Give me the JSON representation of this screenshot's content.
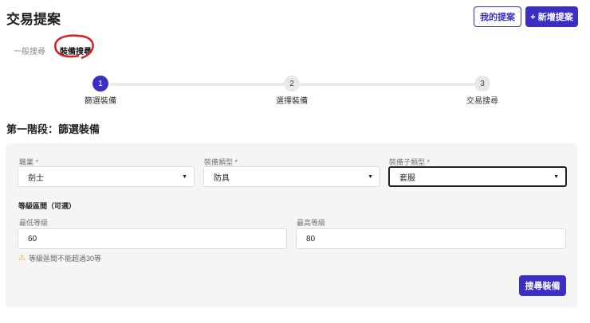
{
  "header": {
    "title": "交易提案",
    "my_proposals": "我的提案",
    "new_proposal": "+ 新增提案"
  },
  "tabs": [
    {
      "label": "一般搜尋"
    },
    {
      "label": "裝備搜尋"
    }
  ],
  "steps": [
    {
      "num": "1",
      "label": "篩選裝備"
    },
    {
      "num": "2",
      "label": "選擇裝備"
    },
    {
      "num": "3",
      "label": "交易搜尋"
    }
  ],
  "section_title": "第一階段：篩選裝備",
  "form": {
    "job": {
      "label": "職業 *",
      "value": "劍士"
    },
    "equip_type": {
      "label": "裝備類型 *",
      "value": "防具"
    },
    "equip_subtype": {
      "label": "裝備子類型 *",
      "value": "套服"
    },
    "level_range_title": "等級區間（可選）",
    "min_level": {
      "label": "最低等級",
      "value": "60"
    },
    "max_level": {
      "label": "最高等級",
      "value": "80"
    },
    "warning": "等級區間不能超過30等",
    "search_button": "搜尋裝備"
  },
  "colors": {
    "primary": "#3a2fc2",
    "annotation": "#d42020",
    "warning": "#e0a800"
  }
}
